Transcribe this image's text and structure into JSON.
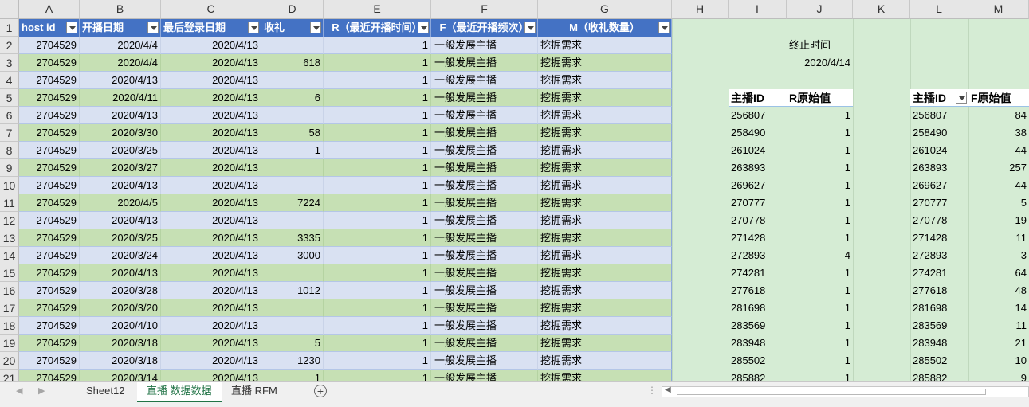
{
  "columns": [
    "A",
    "B",
    "C",
    "D",
    "E",
    "F",
    "G",
    "H",
    "I",
    "J",
    "K",
    "L",
    "M"
  ],
  "rows": [
    "1",
    "2",
    "3",
    "4",
    "5",
    "6",
    "7",
    "8",
    "9",
    "10",
    "11",
    "12",
    "13",
    "14",
    "15",
    "16",
    "17",
    "18",
    "19",
    "20",
    "21"
  ],
  "main_table": {
    "headers": [
      "host id",
      "开播日期",
      "最后登录日期",
      "收礼",
      "R（最近开播时间）",
      "F（最近开播频次）",
      "M（收礼数量）"
    ],
    "data": [
      [
        "2704529",
        "2020/4/4",
        "2020/4/13",
        "",
        "1",
        "一般发展主播",
        "挖掘需求"
      ],
      [
        "2704529",
        "2020/4/4",
        "2020/4/13",
        "618",
        "1",
        "一般发展主播",
        "挖掘需求"
      ],
      [
        "2704529",
        "2020/4/13",
        "2020/4/13",
        "",
        "1",
        "一般发展主播",
        "挖掘需求"
      ],
      [
        "2704529",
        "2020/4/11",
        "2020/4/13",
        "6",
        "1",
        "一般发展主播",
        "挖掘需求"
      ],
      [
        "2704529",
        "2020/4/13",
        "2020/4/13",
        "",
        "1",
        "一般发展主播",
        "挖掘需求"
      ],
      [
        "2704529",
        "2020/3/30",
        "2020/4/13",
        "58",
        "1",
        "一般发展主播",
        "挖掘需求"
      ],
      [
        "2704529",
        "2020/3/25",
        "2020/4/13",
        "1",
        "1",
        "一般发展主播",
        "挖掘需求"
      ],
      [
        "2704529",
        "2020/3/27",
        "2020/4/13",
        "",
        "1",
        "一般发展主播",
        "挖掘需求"
      ],
      [
        "2704529",
        "2020/4/13",
        "2020/4/13",
        "",
        "1",
        "一般发展主播",
        "挖掘需求"
      ],
      [
        "2704529",
        "2020/4/5",
        "2020/4/13",
        "7224",
        "1",
        "一般发展主播",
        "挖掘需求"
      ],
      [
        "2704529",
        "2020/4/13",
        "2020/4/13",
        "",
        "1",
        "一般发展主播",
        "挖掘需求"
      ],
      [
        "2704529",
        "2020/3/25",
        "2020/4/13",
        "3335",
        "1",
        "一般发展主播",
        "挖掘需求"
      ],
      [
        "2704529",
        "2020/3/24",
        "2020/4/13",
        "3000",
        "1",
        "一般发展主播",
        "挖掘需求"
      ],
      [
        "2704529",
        "2020/4/13",
        "2020/4/13",
        "",
        "1",
        "一般发展主播",
        "挖掘需求"
      ],
      [
        "2704529",
        "2020/3/28",
        "2020/4/13",
        "1012",
        "1",
        "一般发展主播",
        "挖掘需求"
      ],
      [
        "2704529",
        "2020/3/20",
        "2020/4/13",
        "",
        "1",
        "一般发展主播",
        "挖掘需求"
      ],
      [
        "2704529",
        "2020/4/10",
        "2020/4/13",
        "",
        "1",
        "一般发展主播",
        "挖掘需求"
      ],
      [
        "2704529",
        "2020/3/18",
        "2020/4/13",
        "5",
        "1",
        "一般发展主播",
        "挖掘需求"
      ],
      [
        "2704529",
        "2020/3/18",
        "2020/4/13",
        "1230",
        "1",
        "一般发展主播",
        "挖掘需求"
      ],
      [
        "2704529",
        "2020/3/14",
        "2020/4/13",
        "1",
        "1",
        "一般发展主播",
        "挖掘需求"
      ]
    ]
  },
  "end_time": {
    "label": "终止时间",
    "value": "2020/4/14"
  },
  "r_table": {
    "headers": [
      "主播ID",
      "R原始值"
    ],
    "data": [
      [
        "256807",
        "1"
      ],
      [
        "258490",
        "1"
      ],
      [
        "261024",
        "1"
      ],
      [
        "263893",
        "1"
      ],
      [
        "269627",
        "1"
      ],
      [
        "270777",
        "1"
      ],
      [
        "270778",
        "1"
      ],
      [
        "271428",
        "1"
      ],
      [
        "272893",
        "4"
      ],
      [
        "274281",
        "1"
      ],
      [
        "277618",
        "1"
      ],
      [
        "281698",
        "1"
      ],
      [
        "283569",
        "1"
      ],
      [
        "283948",
        "1"
      ],
      [
        "285502",
        "1"
      ],
      [
        "285882",
        "1"
      ]
    ]
  },
  "f_table": {
    "headers": [
      "主播ID",
      "F原始值"
    ],
    "data": [
      [
        "256807",
        "84"
      ],
      [
        "258490",
        "38"
      ],
      [
        "261024",
        "44"
      ],
      [
        "263893",
        "257"
      ],
      [
        "269627",
        "44"
      ],
      [
        "270777",
        "5"
      ],
      [
        "270778",
        "19"
      ],
      [
        "271428",
        "11"
      ],
      [
        "272893",
        "3"
      ],
      [
        "274281",
        "64"
      ],
      [
        "277618",
        "48"
      ],
      [
        "281698",
        "14"
      ],
      [
        "283569",
        "11"
      ],
      [
        "283948",
        "21"
      ],
      [
        "285502",
        "10"
      ],
      [
        "285882",
        "9"
      ]
    ]
  },
  "sheet_tabs": [
    "Sheet12",
    "直播 数据数据",
    "直播 RFM"
  ],
  "active_tab": "直播 数据数据",
  "colors": {
    "header_blue": "#4472c4",
    "band_blue": "#d9e1f2",
    "band_green": "#c6e0b4",
    "sheet_green": "#d5ecd4",
    "accent": "#217346"
  }
}
